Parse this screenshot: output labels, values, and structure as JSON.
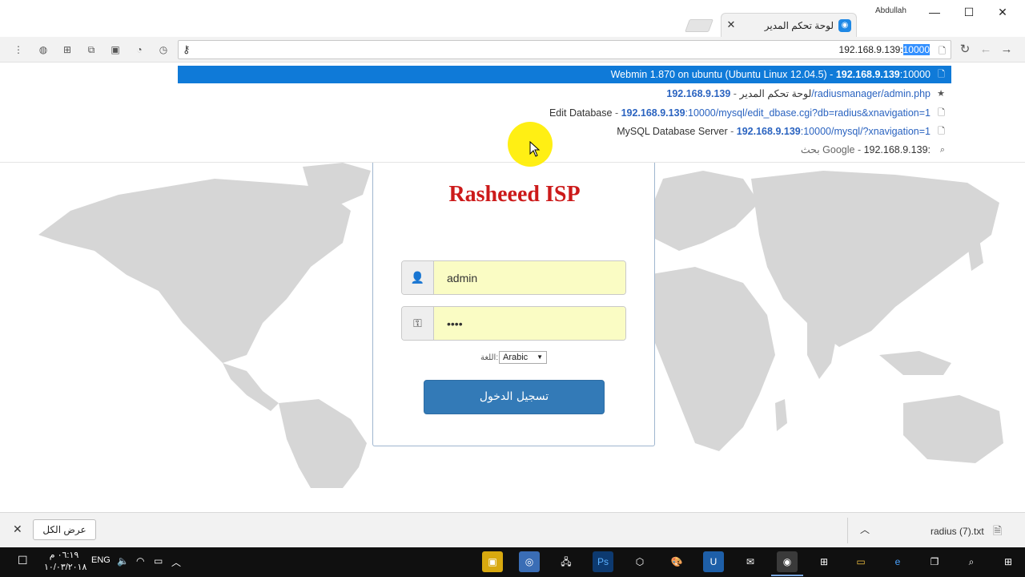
{
  "window": {
    "tab_title": "لوحة تحكم المدير",
    "profile_name": "Abdullah"
  },
  "omnibox": {
    "value_prefix": "192.168.9.139:",
    "value_selected": "10000"
  },
  "suggestions": [
    {
      "title": "Webmin 1.870 on ubuntu (Ubuntu Linux 12.04.5)",
      "sep": " - ",
      "url_bold": "192.168.9.139",
      "url_rest": ":10000",
      "icon": "page-icon"
    },
    {
      "title": "لوحة تحكم المدير",
      "sep": " - ",
      "url_bold": "192.168.9.139",
      "url_rest": "/radiusmanager/admin.php",
      "icon": "star-icon"
    },
    {
      "title": "Edit Database",
      "sep": " - ",
      "url_bold": "192.168.9.139",
      "url_rest": ":10000/mysql/edit_dbase.cgi?db=radius&xnavigation=1",
      "icon": "page-icon"
    },
    {
      "title": "MySQL Database Server",
      "sep": " - ",
      "url_bold": "192.168.9.139",
      "url_rest": ":10000/mysql/?xnavigation=1",
      "icon": "page-icon"
    },
    {
      "title": "192.168.9.139:",
      "sep": " - ",
      "search_text": "بحث Google",
      "icon": "search-icon"
    }
  ],
  "login": {
    "brand": "Rasheeed ISP",
    "username_value": "admin",
    "password_value": "••••",
    "language_label": "اللغة:",
    "language_selected": "Arabic",
    "submit_label": "تسجيل الدخول"
  },
  "downloads": {
    "show_all_label": "عرض الكل",
    "file_name": "radius (7).txt"
  },
  "taskbar": {
    "language": "ENG",
    "time": "٠٦:١٩ م",
    "date": "١٠/٠٣/٢٠١٨"
  },
  "colors": {
    "accent": "#337ab7",
    "selection": "#0f7ad8",
    "brand_red": "#cc1a1a",
    "field_fill": "#fafcc4",
    "map_land": "#d6d6d6"
  }
}
